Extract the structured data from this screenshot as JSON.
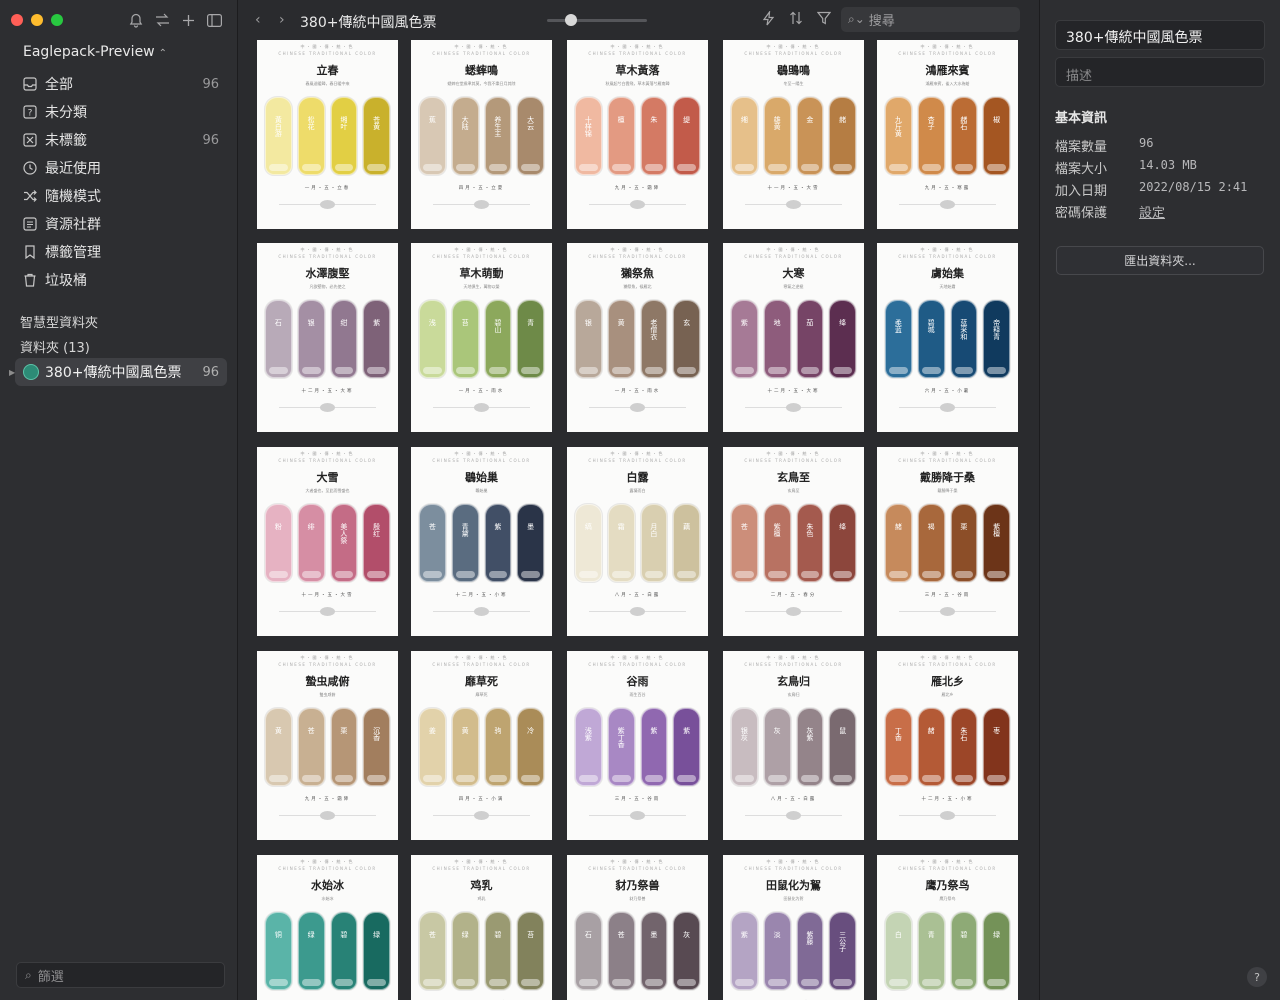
{
  "sidebar": {
    "library_name": "Eaglepack-Preview",
    "items": [
      {
        "label": "全部",
        "count": "96",
        "icon": "inbox-icon"
      },
      {
        "label": "未分類",
        "count": "",
        "icon": "question-box-icon"
      },
      {
        "label": "未標籤",
        "count": "96",
        "icon": "tag-off-icon"
      },
      {
        "label": "最近使用",
        "count": "",
        "icon": "clock-icon"
      },
      {
        "label": "隨機模式",
        "count": "",
        "icon": "shuffle-icon"
      },
      {
        "label": "資源社群",
        "count": "",
        "icon": "community-icon"
      },
      {
        "label": "標籤管理",
        "count": "",
        "icon": "bookmark-icon"
      },
      {
        "label": "垃圾桶",
        "count": "",
        "icon": "trash-icon"
      }
    ],
    "smart_folders_title": "智慧型資料夾",
    "folders_title": "資料夾 (13)",
    "active_folder": {
      "label": "380+傳統中國風色票",
      "count": "96"
    },
    "filter_placeholder": "篩選"
  },
  "toolbar": {
    "title": "380+傳統中國風色票",
    "search_placeholder": "搜尋",
    "zoom_level": 0.2
  },
  "cards": [
    {
      "title": "立春",
      "subtitle": "春風送暖歸，春日暖中來",
      "date": "一月・五・立春",
      "colors": [
        "#f3e9a0",
        "#eedc6a",
        "#e2cf44",
        "#c9b12c"
      ],
      "names": [
        "黃白游",
        "松花",
        "缃叶",
        "苍黄"
      ]
    },
    {
      "title": "蟋蟀鳴",
      "subtitle": "蟋蟀在堂歲聿其莫，今我不樂日月其除",
      "date": "四月・五・立夏",
      "colors": [
        "#d8c8b4",
        "#c4ac8e",
        "#b4997a",
        "#a88a6c"
      ],
      "names": [
        "蕉",
        "大陆",
        "养生主",
        "大云"
      ]
    },
    {
      "title": "草木黃落",
      "subtitle": "秋風起兮白雲飛，草木黃落兮雁南歸",
      "date": "九月・五・霜降",
      "colors": [
        "#f0b9a1",
        "#e39a82",
        "#d47a64",
        "#c25b4a"
      ],
      "names": [
        "十样锦",
        "檀",
        "朱",
        "缇"
      ]
    },
    {
      "title": "鶡鴠鳴",
      "subtitle": "冬至一陽生",
      "date": "十一月・五・大雪",
      "colors": [
        "#e6c08a",
        "#d9a96a",
        "#c99357",
        "#b57d43"
      ],
      "names": [
        "缃",
        "雄黄",
        "金",
        "赭"
      ]
    },
    {
      "title": "鴻雁來賓",
      "subtitle": "鴻雁來賓，雀入大水為蛤",
      "date": "九月・五・寒露",
      "colors": [
        "#e0a86a",
        "#d08a4a",
        "#bb6c34",
        "#a45622"
      ],
      "names": [
        "九斤黄",
        "杏子",
        "赭石",
        "椒"
      ]
    },
    {
      "title": "水澤腹堅",
      "subtitle": "凡欲堅物，必先使之",
      "date": "十二月・五・大寒",
      "colors": [
        "#b8aab8",
        "#a48fa4",
        "#917890",
        "#7e6278"
      ],
      "names": [
        "石",
        "银",
        "绀",
        "紫"
      ]
    },
    {
      "title": "草木萌動",
      "subtitle": "天地俱生，萬物以榮",
      "date": "一月・五・雨水",
      "colors": [
        "#c9da9a",
        "#aac67a",
        "#8ca85c",
        "#6e8a48"
      ],
      "names": [
        "浅",
        "苔",
        "碧山",
        "青"
      ]
    },
    {
      "title": "獺祭魚",
      "subtitle": "獺祭魚，候雁北",
      "date": "一月・五・雨水",
      "colors": [
        "#b8a89a",
        "#a8907e",
        "#8e7866",
        "#776252"
      ],
      "names": [
        "银",
        "黄",
        "老僧衣",
        "玄"
      ]
    },
    {
      "title": "大寒",
      "subtitle": "寒氣之逆極",
      "date": "十二月・五・大寒",
      "colors": [
        "#a67a96",
        "#8e5c7c",
        "#764466",
        "#5c2e50"
      ],
      "names": [
        "紫",
        "地",
        "茄",
        "绛"
      ]
    },
    {
      "title": "虜始集",
      "subtitle": "天地始肅",
      "date": "六月・五・小暑",
      "colors": [
        "#2c6e9a",
        "#1f5b86",
        "#174a74",
        "#103a5e"
      ],
      "names": [
        "柔蓝",
        "碧城",
        "蓝采和",
        "帝释青"
      ]
    },
    {
      "title": "大雪",
      "subtitle": "大者盛也，至此而雪盛也",
      "date": "十一月・五・大雪",
      "colors": [
        "#e6b2c2",
        "#d68ea4",
        "#c46c86",
        "#b24e6a"
      ],
      "names": [
        "粉",
        "绯",
        "美人祭",
        "殷红"
      ]
    },
    {
      "title": "鶡始巢",
      "subtitle": "鶡始巢",
      "date": "十二月・五・小寒",
      "colors": [
        "#7c8e9e",
        "#5a6c80",
        "#414f66",
        "#2a3448"
      ],
      "names": [
        "苍",
        "青黛",
        "紫",
        "墨"
      ]
    },
    {
      "title": "白露",
      "subtitle": "露凝而白",
      "date": "八月・五・白露",
      "colors": [
        "#eee8d6",
        "#e4dcc2",
        "#d9cfb0",
        "#cdc19e"
      ],
      "names": [
        "缟",
        "霜",
        "月白",
        "藕"
      ]
    },
    {
      "title": "玄鳥至",
      "subtitle": "玄鳥至",
      "date": "二月・五・春分",
      "colors": [
        "#cc8e7a",
        "#b87262",
        "#a45a4e",
        "#8c463c"
      ],
      "names": [
        "苍",
        "紫檀",
        "朱色",
        "绛"
      ]
    },
    {
      "title": "戴勝降于桑",
      "subtitle": "戴勝降于桑",
      "date": "三月・五・谷雨",
      "colors": [
        "#c68a5c",
        "#a8683c",
        "#8c4e28",
        "#6c3418"
      ],
      "names": [
        "赭",
        "褐",
        "栗",
        "紫檀"
      ]
    },
    {
      "title": "蟄虫咸俯",
      "subtitle": "蟄虫咸俯",
      "date": "九月・五・霜降",
      "colors": [
        "#d8c8b0",
        "#c8b092",
        "#b69676",
        "#a27e5e"
      ],
      "names": [
        "黄",
        "苍",
        "栗",
        "沉香"
      ]
    },
    {
      "title": "靡草死",
      "subtitle": "靡草死",
      "date": "四月・五・小满",
      "colors": [
        "#e2d2aa",
        "#d2bc8c",
        "#bea470",
        "#aa8c58"
      ],
      "names": [
        "姜",
        "黄",
        "驹",
        "冷"
      ]
    },
    {
      "title": "谷雨",
      "subtitle": "雨生百谷",
      "date": "三月・五・谷雨",
      "colors": [
        "#c0a8d6",
        "#a888c4",
        "#9068b0",
        "#78509a"
      ],
      "names": [
        "浅紫",
        "紫丁香",
        "紫",
        "紫"
      ]
    },
    {
      "title": "玄鳥归",
      "subtitle": "玄鳥归",
      "date": "八月・五・白露",
      "colors": [
        "#c8bcc0",
        "#aea0a6",
        "#94848a",
        "#7a6a70"
      ],
      "names": [
        "银灰",
        "灰",
        "灰紫",
        "鼠"
      ]
    },
    {
      "title": "雁北乡",
      "subtitle": "雁北乡",
      "date": "十二月・五・小寒",
      "colors": [
        "#c86e48",
        "#b45a36",
        "#9c4628",
        "#82341c"
      ],
      "names": [
        "丁香",
        "赭",
        "朱石",
        "枣"
      ]
    },
    {
      "title": "水始冰",
      "subtitle": "水始冰",
      "date": "十月・五・立冬",
      "colors": [
        "#5ab4a8",
        "#3c9a8e",
        "#288276",
        "#186a60"
      ],
      "names": [
        "铜",
        "绿",
        "碧",
        "绿"
      ]
    },
    {
      "title": "鸡乳",
      "subtitle": "鸡乳",
      "date": "十二月・五・大寒",
      "colors": [
        "#c8c8a4",
        "#b2b28a",
        "#9a9a72",
        "#82825c"
      ],
      "names": [
        "苍",
        "绿",
        "碧",
        "苔"
      ]
    },
    {
      "title": "豺乃祭兽",
      "subtitle": "豺乃祭兽",
      "date": "九月・五・霜降",
      "colors": [
        "#a8a0a4",
        "#8c8088",
        "#72646c",
        "#584a52"
      ],
      "names": [
        "石",
        "苍",
        "墨",
        "灰"
      ]
    },
    {
      "title": "田鼠化为鴽",
      "subtitle": "田鼠化为鴽",
      "date": "三月・五・清明",
      "colors": [
        "#b4a4c4",
        "#9a86ae",
        "#806a96",
        "#684e7e"
      ],
      "names": [
        "紫",
        "淡",
        "紫藤",
        "三公子"
      ]
    },
    {
      "title": "鹰乃祭鸟",
      "subtitle": "鹰乃祭鸟",
      "date": "七月・五・处暑",
      "colors": [
        "#c4d4b4",
        "#aac094",
        "#8eaa76",
        "#749258"
      ],
      "names": [
        "白",
        "青",
        "碧",
        "绿"
      ]
    }
  ],
  "card_header": "中・國・傳・統・色",
  "card_header_en": "CHINESE TRADITIONAL COLOR",
  "inspector": {
    "name": "380+傳統中國風色票",
    "description_placeholder": "描述",
    "info_title": "基本資訊",
    "rows": [
      {
        "key": "檔案數量",
        "value": "96"
      },
      {
        "key": "檔案大小",
        "value": "14.03 MB"
      },
      {
        "key": "加入日期",
        "value": "2022/08/15 2:41"
      },
      {
        "key": "密碼保護",
        "value": "設定"
      }
    ],
    "export_label": "匯出資料夾...",
    "help_label": "?"
  }
}
